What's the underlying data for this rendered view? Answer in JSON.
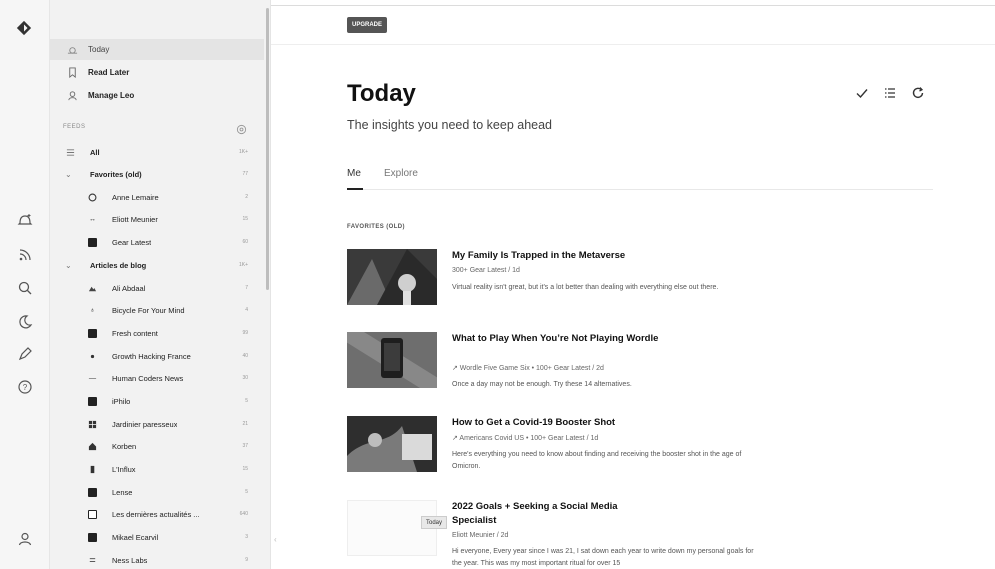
{
  "rail": {
    "icons": [
      "logo-icon",
      "add-feed-icon",
      "rss-icon",
      "search-icon",
      "moon-icon",
      "pen-icon",
      "help-icon",
      "account-icon"
    ]
  },
  "sidebar": {
    "nav": [
      {
        "label": "Today",
        "icon": "sun-icon"
      },
      {
        "label": "Read Later",
        "icon": "bookmark-icon"
      },
      {
        "label": "Manage Leo",
        "icon": "leo-icon"
      }
    ],
    "feeds_header": "FEEDS",
    "feeds": [
      {
        "label": "All",
        "count": "1K+",
        "kind": "all",
        "icon": "list-icon"
      },
      {
        "label": "Favorites (old)",
        "count": "77",
        "kind": "group",
        "icon": "chevron-down-icon"
      },
      {
        "label": "Anne Lemaire",
        "count": "2",
        "kind": "child",
        "icon": "circle-icon"
      },
      {
        "label": "Eliott Meunier",
        "count": "15",
        "kind": "child",
        "icon": "arrows-icon"
      },
      {
        "label": "Gear Latest",
        "count": "60",
        "kind": "child",
        "icon": "square-icon"
      },
      {
        "label": "Articles de blog",
        "count": "1K+",
        "kind": "group",
        "icon": "chevron-down-icon"
      },
      {
        "label": "Ali Abdaal",
        "count": "7",
        "kind": "child",
        "icon": "mountain-icon"
      },
      {
        "label": "Bicycle For Your Mind",
        "count": "4",
        "kind": "child",
        "icon": "bicycle-icon"
      },
      {
        "label": "Fresh content",
        "count": "99",
        "kind": "child",
        "icon": "square-icon"
      },
      {
        "label": "Growth Hacking France",
        "count": "40",
        "kind": "child",
        "icon": "dot-icon"
      },
      {
        "label": "Human Coders News",
        "count": "30",
        "kind": "child",
        "icon": "dash-icon"
      },
      {
        "label": "iPhilo",
        "count": "5",
        "kind": "child",
        "icon": "square-icon"
      },
      {
        "label": "Jardinier paresseux",
        "count": "21",
        "kind": "child",
        "icon": "grid-icon"
      },
      {
        "label": "Korben",
        "count": "37",
        "kind": "child",
        "icon": "house-icon"
      },
      {
        "label": "L'Influx",
        "count": "15",
        "kind": "child",
        "icon": "bar-icon"
      },
      {
        "label": "Lense",
        "count": "5",
        "kind": "child",
        "icon": "square-icon"
      },
      {
        "label": "Les dernières actualités ...",
        "count": "640",
        "kind": "child",
        "icon": "square-outline-icon"
      },
      {
        "label": "Mikael Ecarvil",
        "count": "3",
        "kind": "child",
        "icon": "square-icon"
      },
      {
        "label": "Ness Labs",
        "count": "9",
        "kind": "child",
        "icon": "lines-icon"
      }
    ]
  },
  "main": {
    "upgrade_label": "UPGRADE",
    "title": "Today",
    "subtitle": "The insights you need to keep ahead",
    "tools": [
      "check-icon",
      "list-view-icon",
      "refresh-icon"
    ],
    "tabs": [
      {
        "label": "Me"
      },
      {
        "label": "Explore"
      }
    ],
    "section_title": "FAVORITES (OLD)",
    "articles": [
      {
        "title": "My Family Is Trapped in the Metaverse",
        "meta": "300+  Gear Latest / 1d",
        "desc": "Virtual reality isn't great, but it's a lot better than dealing with everything else out there."
      },
      {
        "title": "What to Play When You’re Not Playing Wordle",
        "meta": "↗ Wordle Five Game Six  •  100+  Gear Latest / 2d",
        "desc": "Once a day may not be enough. Try these 14 alternatives."
      },
      {
        "title": "How to Get a Covid-19 Booster Shot",
        "meta": "↗ Americans Covid US  •  100+  Gear Latest / 1d",
        "desc": "Here's everything you need to know about finding and receiving the booster shot in the age of Omicron."
      },
      {
        "title": "2022 Goals + Seeking a Social Media Specialist",
        "meta": "Eliott Meunier / 2d",
        "desc": "Hi everyone, Every year since I was 21, I sat down each year to write down my personal goals for the year. This was my most important ritual for over 15"
      }
    ],
    "tooltip": "Today"
  }
}
